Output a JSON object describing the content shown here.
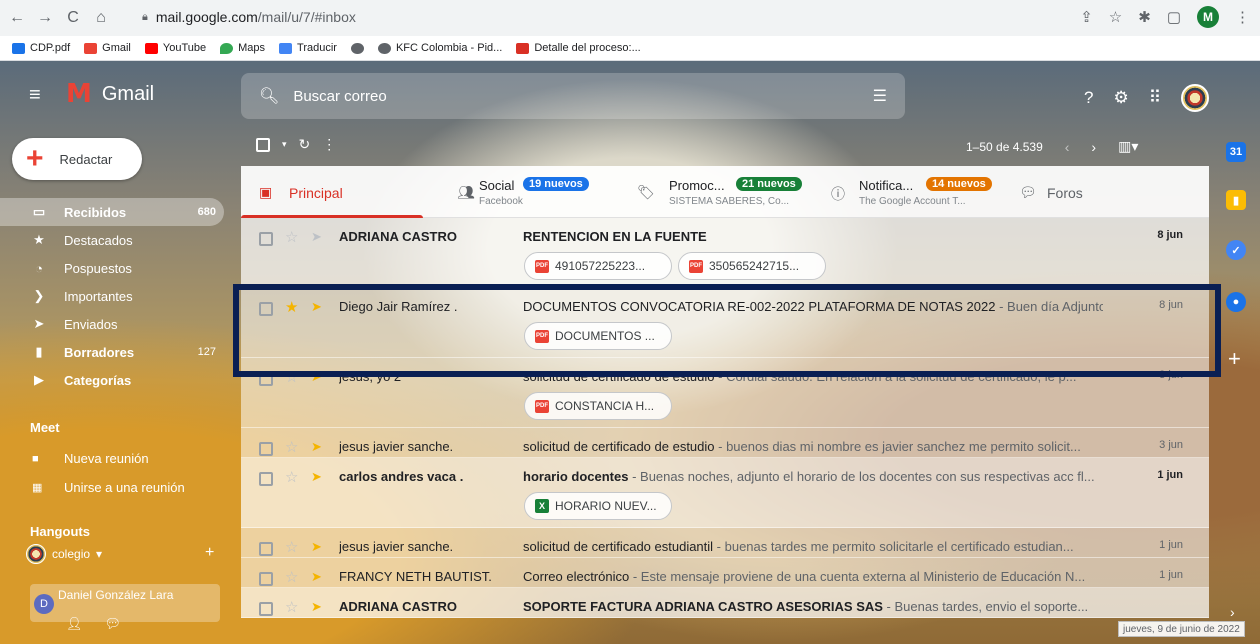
{
  "browser": {
    "url_host": "mail.google.com",
    "url_path": "/mail/u/7/#inbox",
    "profile_initial": "M",
    "bookmarks": [
      {
        "label": "CDP.pdf",
        "color": "#1a73e8"
      },
      {
        "label": "Gmail",
        "color": "#ea4335"
      },
      {
        "label": "YouTube",
        "color": "#ff0000"
      },
      {
        "label": "Maps",
        "color": "#34a853"
      },
      {
        "label": "Traducir",
        "color": "#4285f4"
      },
      {
        "label": "",
        "color": "#5f6368"
      },
      {
        "label": "KFC Colombia - Pid...",
        "color": "#5f6368"
      },
      {
        "label": "Detalle del proceso:...",
        "color": "#d93025"
      }
    ]
  },
  "header": {
    "app_name": "Gmail",
    "search_placeholder": "Buscar correo"
  },
  "sidebar": {
    "compose_label": "Redactar",
    "items": [
      {
        "label": "Recibidos",
        "count": "680",
        "icon": "inbox-icon",
        "glyph": "▭"
      },
      {
        "label": "Destacados",
        "count": "",
        "icon": "star-icon",
        "glyph": "★"
      },
      {
        "label": "Pospuestos",
        "count": "",
        "icon": "clock-icon",
        "glyph": "◔"
      },
      {
        "label": "Importantes",
        "count": "",
        "icon": "important-icon",
        "glyph": "❯"
      },
      {
        "label": "Enviados",
        "count": "",
        "icon": "send-icon",
        "glyph": "➤"
      },
      {
        "label": "Borradores",
        "count": "127",
        "icon": "draft-icon",
        "glyph": "▮"
      },
      {
        "label": "Categorías",
        "count": "",
        "icon": "label-icon",
        "glyph": "▶"
      }
    ],
    "meet_title": "Meet",
    "meet_items": [
      "Nueva reunión",
      "Unirse a una reunión"
    ],
    "hangouts_title": "Hangouts",
    "hangouts_user": "colegio",
    "hangouts_contact": "Daniel González Lara"
  },
  "toolbar": {
    "pagination": "1–50 de 4.539"
  },
  "tabs": [
    {
      "label": "Principal"
    },
    {
      "label": "Social",
      "badge": "19 nuevos",
      "badge_color": "#1a73e8",
      "sub": "Facebook"
    },
    {
      "label": "Promoc...",
      "badge": "21 nuevos",
      "badge_color": "#188038",
      "sub": "SISTEMA SABERES, Co..."
    },
    {
      "label": "Notifica...",
      "badge": "14 nuevos",
      "badge_color": "#e37400",
      "sub": "The Google Account T..."
    },
    {
      "label": "Foros"
    }
  ],
  "emails": [
    {
      "from": "ADRIANA CASTRO",
      "subject": "RENTENCION EN LA FUENTE",
      "snippet": "",
      "date": "8 jun",
      "unread": true,
      "starred": false,
      "important": false,
      "attachments": [
        {
          "name": "491057225223...",
          "type": "pdf"
        },
        {
          "name": "350565242715...",
          "type": "pdf"
        }
      ]
    },
    {
      "from": "Diego Jair Ramírez .",
      "subject": "DOCUMENTOS CONVOCATORIA RE-002-2022 PLATAFORMA DE NOTAS 2022",
      "snippet": " - Buen día Adjunto...",
      "date": "8 jun",
      "unread": false,
      "starred": true,
      "important": true,
      "attachments": [
        {
          "name": "DOCUMENTOS ...",
          "type": "pdf"
        }
      ]
    },
    {
      "from": "jesus, yo 2",
      "subject": "solicitud de certificado de estudio",
      "snippet": " - Cordial saludo. En relación a la solicitud de certificado, le p...",
      "date": "3 jun",
      "unread": false,
      "starred": false,
      "important": true,
      "attachments": [
        {
          "name": "CONSTANCIA H...",
          "type": "pdf"
        }
      ]
    },
    {
      "from": "jesus javier sanche.",
      "subject": "solicitud de certificado de estudio",
      "snippet": " - buenos dias mi nombre es javier sanchez me permito solicit...",
      "date": "3 jun",
      "unread": false,
      "starred": false,
      "important": true,
      "attachments": []
    },
    {
      "from": "carlos andres vaca .",
      "subject": "horario docentes",
      "snippet": " - Buenas noches, adjunto el horario de los docentes con sus respectivas acc fl...",
      "date": "1 jun",
      "unread": true,
      "starred": false,
      "important": true,
      "attachments": [
        {
          "name": "HORARIO NUEV...",
          "type": "xls"
        }
      ]
    },
    {
      "from": "jesus javier sanche.",
      "subject": "solicitud de certificado estudiantil",
      "snippet": " - buenas tardes me permito solicitarle el certificado estudian...",
      "date": "1 jun",
      "unread": false,
      "starred": false,
      "important": true,
      "attachments": []
    },
    {
      "from": "FRANCY NETH BAUTIST.",
      "subject": "Correo electrónico",
      "snippet": " - Este mensaje proviene de una cuenta externa al Ministerio de Educación N...",
      "date": "1 jun",
      "unread": false,
      "starred": false,
      "important": true,
      "attachments": []
    },
    {
      "from": "ADRIANA CASTRO",
      "subject": "SOPORTE FACTURA ADRIANA CASTRO ASESORIAS SAS",
      "snippet": " - Buenas tardes, envio el soporte...",
      "date": "",
      "unread": true,
      "starred": false,
      "important": true,
      "attachments": []
    }
  ],
  "tooltip": "jueves, 9 de junio de 2022"
}
